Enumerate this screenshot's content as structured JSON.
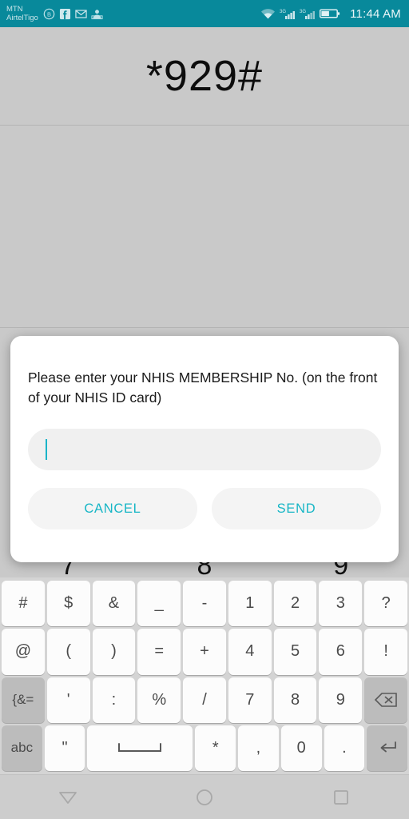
{
  "statusbar": {
    "carrier": "MTN\nAirtelTigo",
    "clock": "11:44 AM",
    "left_icons": [
      "bbm-circle-b-icon",
      "facebook-icon",
      "gmail-icon",
      "app-notification-icon"
    ],
    "right_icons": [
      "wifi-icon",
      "signal-3g-sim1-icon",
      "signal-3g-sim2-icon",
      "battery-icon"
    ],
    "network_label": "3G",
    "bg_color": "#08899b"
  },
  "header": {
    "ussd_code": "*929#"
  },
  "dialpad_peek": {
    "digits": [
      "7",
      "8",
      "9"
    ]
  },
  "dialog": {
    "message": "Please enter your NHIS MEMBERSHIP No. (on the front of your NHIS ID card)",
    "input": {
      "value": "",
      "placeholder": ""
    },
    "cancel_label": "CANCEL",
    "send_label": "SEND",
    "accent_color": "#17b6c6"
  },
  "keyboard": {
    "rows": [
      [
        {
          "label": "#",
          "type": "char"
        },
        {
          "label": "$",
          "type": "char"
        },
        {
          "label": "&",
          "type": "char"
        },
        {
          "label": "_",
          "type": "char"
        },
        {
          "label": "-",
          "type": "char"
        },
        {
          "label": "1",
          "type": "char"
        },
        {
          "label": "2",
          "type": "char"
        },
        {
          "label": "3",
          "type": "char"
        },
        {
          "label": "?",
          "type": "char"
        }
      ],
      [
        {
          "label": "@",
          "type": "char"
        },
        {
          "label": "(",
          "type": "char"
        },
        {
          "label": ")",
          "type": "char"
        },
        {
          "label": "=",
          "type": "char"
        },
        {
          "label": "+",
          "type": "char"
        },
        {
          "label": "4",
          "type": "char"
        },
        {
          "label": "5",
          "type": "char"
        },
        {
          "label": "6",
          "type": "char"
        },
        {
          "label": "!",
          "type": "char"
        }
      ],
      [
        {
          "label": "{&=",
          "type": "mod"
        },
        {
          "label": "'",
          "type": "char"
        },
        {
          "label": ":",
          "type": "char"
        },
        {
          "label": "%",
          "type": "char"
        },
        {
          "label": "/",
          "type": "char"
        },
        {
          "label": "7",
          "type": "char"
        },
        {
          "label": "8",
          "type": "char"
        },
        {
          "label": "9",
          "type": "char"
        },
        {
          "label": "",
          "type": "backspace",
          "icon": "backspace-icon"
        }
      ],
      [
        {
          "label": "abc",
          "type": "mod"
        },
        {
          "label": "\"",
          "type": "char"
        },
        {
          "label": "",
          "type": "space",
          "icon": "space-icon"
        },
        {
          "label": "*",
          "type": "char"
        },
        {
          "label": ",",
          "type": "char"
        },
        {
          "label": "0",
          "type": "char"
        },
        {
          "label": ".",
          "type": "char"
        },
        {
          "label": "",
          "type": "enter",
          "icon": "enter-icon"
        }
      ]
    ]
  },
  "navbar": {
    "back": "back-nav-icon",
    "home": "home-nav-icon",
    "recents": "recents-nav-icon"
  }
}
